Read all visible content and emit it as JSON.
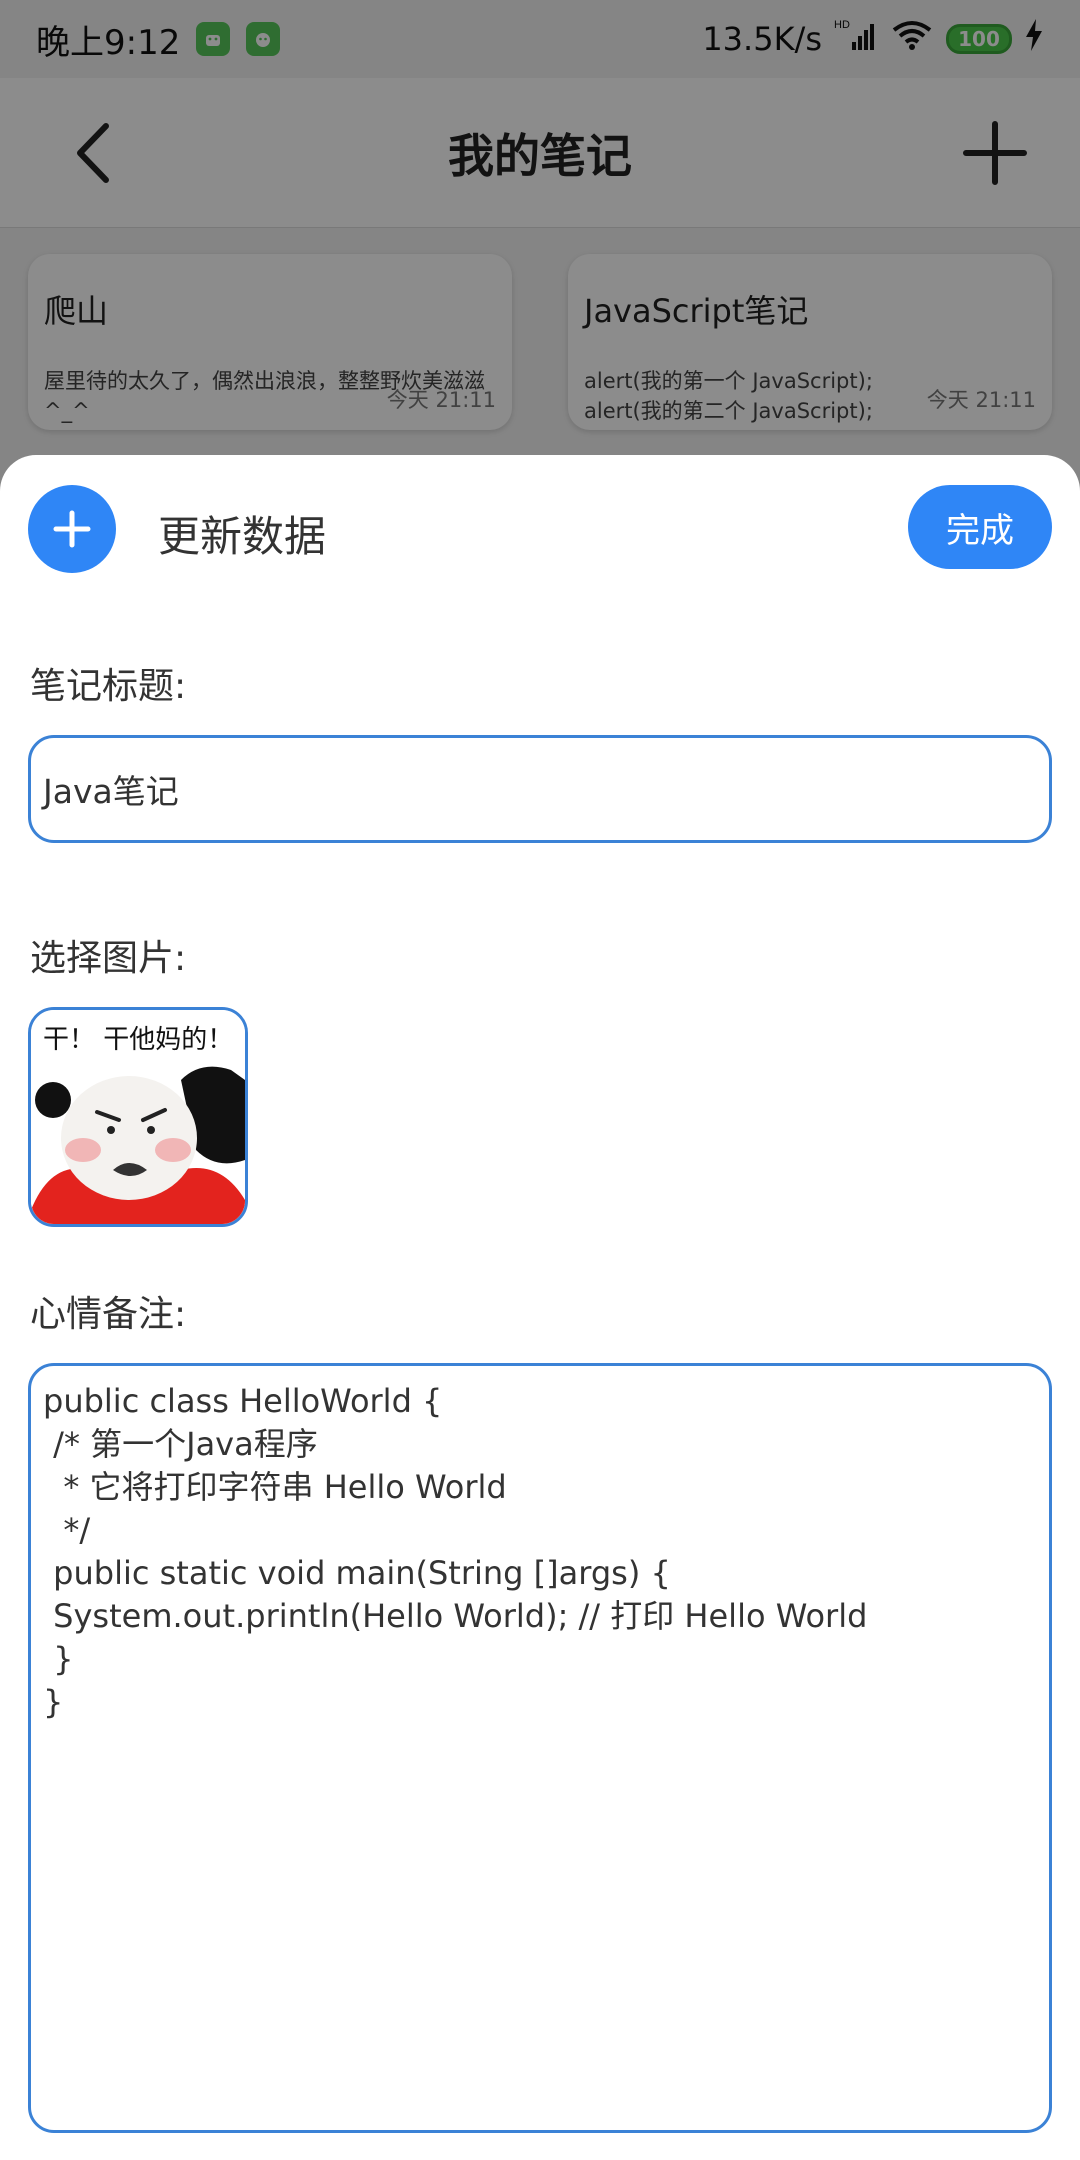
{
  "status_bar": {
    "time": "晚上9:12",
    "network_speed": "13.5K/s",
    "network_badge": "HD",
    "battery": "100",
    "badge_colors": [
      "#57c75a",
      "#57c75a"
    ]
  },
  "app_bar": {
    "title": "我的笔记",
    "back_icon": "chevron-left-icon",
    "add_icon": "plus-icon"
  },
  "notes": [
    {
      "title": "爬山",
      "body": "屋里待的太久了，偶然出浪浪，整整野炊美滋滋\n^_^",
      "time": "今天 21:11"
    },
    {
      "title": "JavaScript笔记",
      "body": "alert(我的第一个 JavaScript);\nalert(我的第二个 JavaScript);",
      "time": "今天 21:11"
    }
  ],
  "sheet": {
    "title": "更新数据",
    "done_label": "完成",
    "accent_color": "#2f86f6",
    "title_label": "笔记标题:",
    "title_value": "Java笔记",
    "image_label": "选择图片:",
    "image_caption": "干！ 干他妈的！",
    "mood_label": "心情备注:",
    "mood_lines": [
      "public class HelloWorld {",
      " /* 第一个Java程序",
      "  * 它将打印字符串 Hello World",
      "  */",
      " public static void main(String []args) {",
      " System.out.println(Hello World); // 打印 Hello World",
      " }",
      "}"
    ]
  }
}
